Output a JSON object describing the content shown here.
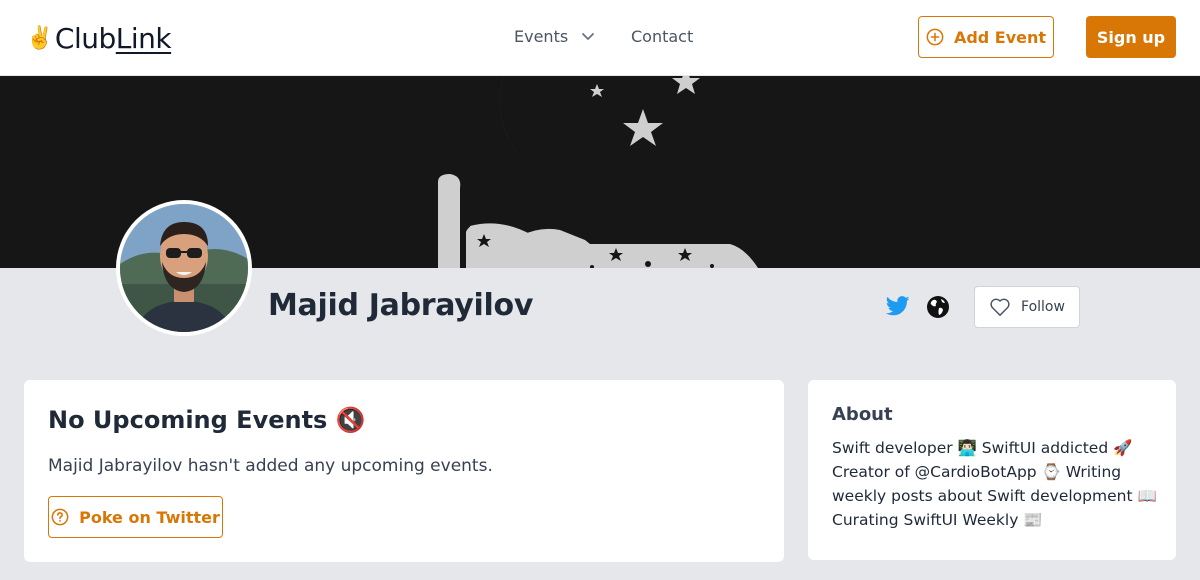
{
  "brand": {
    "emoji": "✌️",
    "name_part1": "Club",
    "name_part2": "Link"
  },
  "nav": {
    "events_label": "Events",
    "contact_label": "Contact"
  },
  "header_actions": {
    "add_event_label": "Add Event",
    "signup_label": "Sign up"
  },
  "profile": {
    "name": "Majid Jabrayilov",
    "follow_label": "Follow"
  },
  "events_card": {
    "title": "No Upcoming Events 🔇",
    "message": "Majid Jabrayilov hasn't added any upcoming events.",
    "poke_label": "Poke on Twitter"
  },
  "about_card": {
    "title": "About",
    "text": "Swift developer 👨🏻‍💻 SwiftUI addicted 🚀 Creator of @CardioBotApp ⌚ Writing weekly posts about Swift development 📖 Curating SwiftUI Weekly 📰"
  },
  "colors": {
    "accent": "#d97706",
    "banner": "#161616",
    "page_bg": "#e5e7eb",
    "twitter": "#1d9bf0"
  },
  "icons": [
    "chevron-down-icon",
    "plus-circle-icon",
    "twitter-icon",
    "globe-icon",
    "heart-icon",
    "question-circle-icon"
  ]
}
